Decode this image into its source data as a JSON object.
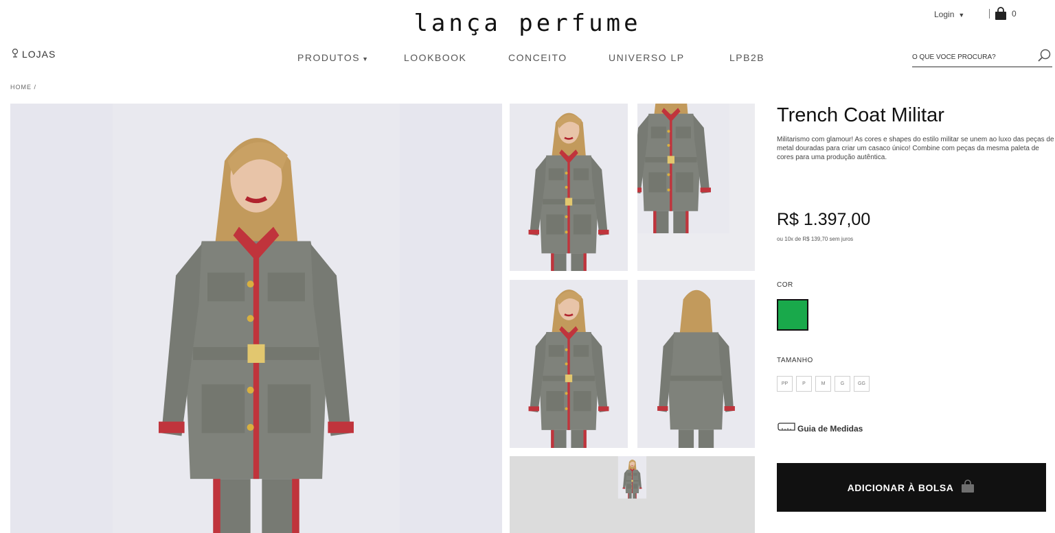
{
  "header": {
    "logo": "lança perfume",
    "login_label": "Login",
    "bag_count": "0",
    "stores_label": "LOJAS",
    "search": {
      "placeholder": "O QUE VOCÊ PROCURA?"
    }
  },
  "nav": {
    "items": [
      {
        "label": "PRODUTOS",
        "has_dropdown": true
      },
      {
        "label": "LOOKBOOK"
      },
      {
        "label": "CONCEITO"
      },
      {
        "label": "UNIVERSO LP"
      },
      {
        "label": "LPB2B"
      }
    ]
  },
  "breadcrumb": "HOME /",
  "product": {
    "title": "Trench Coat Militar",
    "description": "Militarismo com glamour! As cores e shapes do estilo militar se unem ao luxo das peças de metal douradas para criar um casaco único! Combine com peças da mesma paleta de cores para uma produção autêntica.",
    "price": "R$ 1.397,00",
    "installments": "ou 10x de R$ 139,70 sem juros",
    "color_label": "COR",
    "size_label": "TAMANHO",
    "sizes": [
      "PP",
      "P",
      "M",
      "G",
      "GG"
    ],
    "size_guide_label": "Guia de Medidas",
    "add_to_bag_label": "ADICIONAR À BOLSA"
  },
  "colors": {
    "swatch": "#19a94b",
    "button_bg": "#111111",
    "coat": "#7f827b",
    "trim": "#c0343c"
  },
  "icons": {
    "stores": "pin-icon",
    "bag": "shopping-bag-icon",
    "search": "search-icon",
    "size_guide": "ruler-icon",
    "add_to_bag": "shopping-bag-icon"
  }
}
